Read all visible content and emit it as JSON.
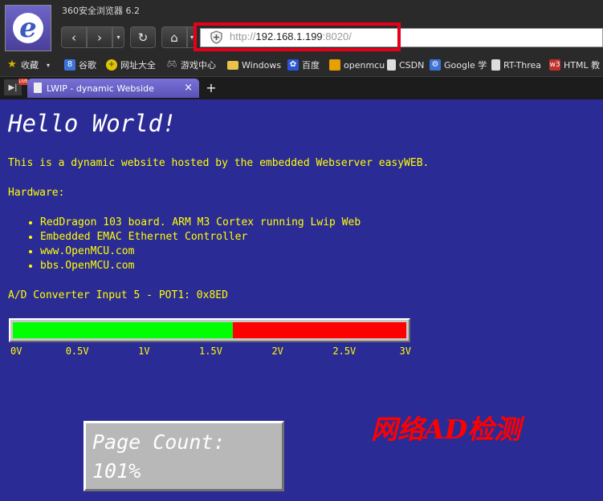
{
  "window": {
    "title": "360安全浏览器 6.2"
  },
  "toolbar": {
    "back_icon": "‹",
    "forward_icon": "›",
    "dropdown_icon": "▾",
    "reload_icon": "↻",
    "home_icon": "⌂"
  },
  "address": {
    "scheme": "http://",
    "host": "192.168.1.199",
    "port": ":8020/"
  },
  "bookmarks": [
    {
      "label": "收藏",
      "icon": "star-icon",
      "color": "#e0b000"
    },
    {
      "label": "谷歌",
      "icon": "google-icon",
      "color": "#3b73d9"
    },
    {
      "label": "网址大全",
      "icon": "plus-icon",
      "color": "#2aa52a"
    },
    {
      "label": "游戏中心",
      "icon": "gamepad-icon",
      "color": "#777777"
    },
    {
      "label": "Windows",
      "icon": "folder-icon",
      "color": "#e8c24a"
    },
    {
      "label": "百度",
      "icon": "baidu-paw-icon",
      "color": "#2a56d6"
    },
    {
      "label": "openmcu",
      "icon": "openmcu-icon",
      "color": "#e8a000"
    },
    {
      "label": "CSDN",
      "icon": "page-icon",
      "color": "#dddddd"
    },
    {
      "label": "Google 学",
      "icon": "scholar-icon",
      "color": "#3b73d9"
    },
    {
      "label": "RT-Threa",
      "icon": "page-icon",
      "color": "#dddddd"
    },
    {
      "label": "HTML 教",
      "icon": "w3-icon",
      "color": "#c0302a"
    }
  ],
  "bookmarks_extra": {
    "w3_text": "w3",
    "google_text": "8",
    "sidebar_badge": "LIVE"
  },
  "tab": {
    "title": "LWIP - dynamic Webside",
    "close_icon": "×",
    "new_tab_icon": "+"
  },
  "page": {
    "heading": "Hello World!",
    "intro": "This is a dynamic website hosted by the embedded Webserver easyWEB.",
    "hardware_label": "Hardware:",
    "hardware_items": [
      "RedDragon 103 board. ARM M3 Cortex running Lwip Web",
      "Embedded EMAC Ethernet Controller",
      "www.OpenMCU.com",
      "bbs.OpenMCU.com"
    ],
    "ad_line": "A/D Converter Input 5 - POT1: 0x8ED",
    "ad_fraction": 0.5583,
    "scale": [
      {
        "label": "0V",
        "value": 0.0
      },
      {
        "label": "0.5V",
        "value": 0.5
      },
      {
        "label": "1V",
        "value": 1.0
      },
      {
        "label": "1.5V",
        "value": 1.5
      },
      {
        "label": "2V",
        "value": 2.0
      },
      {
        "label": "2.5V",
        "value": 2.5
      },
      {
        "label": "3V",
        "value": 3.0
      }
    ],
    "counter_text": "Page Count:",
    "counter_value": "101%",
    "overlay_caption": "网络AD检测",
    "colors": {
      "bar_fill": "#00ff00",
      "bar_rest": "#ff0000",
      "page_bg": "#2b2b96",
      "text": "#ffff00",
      "highlight": "#e8001a"
    }
  }
}
